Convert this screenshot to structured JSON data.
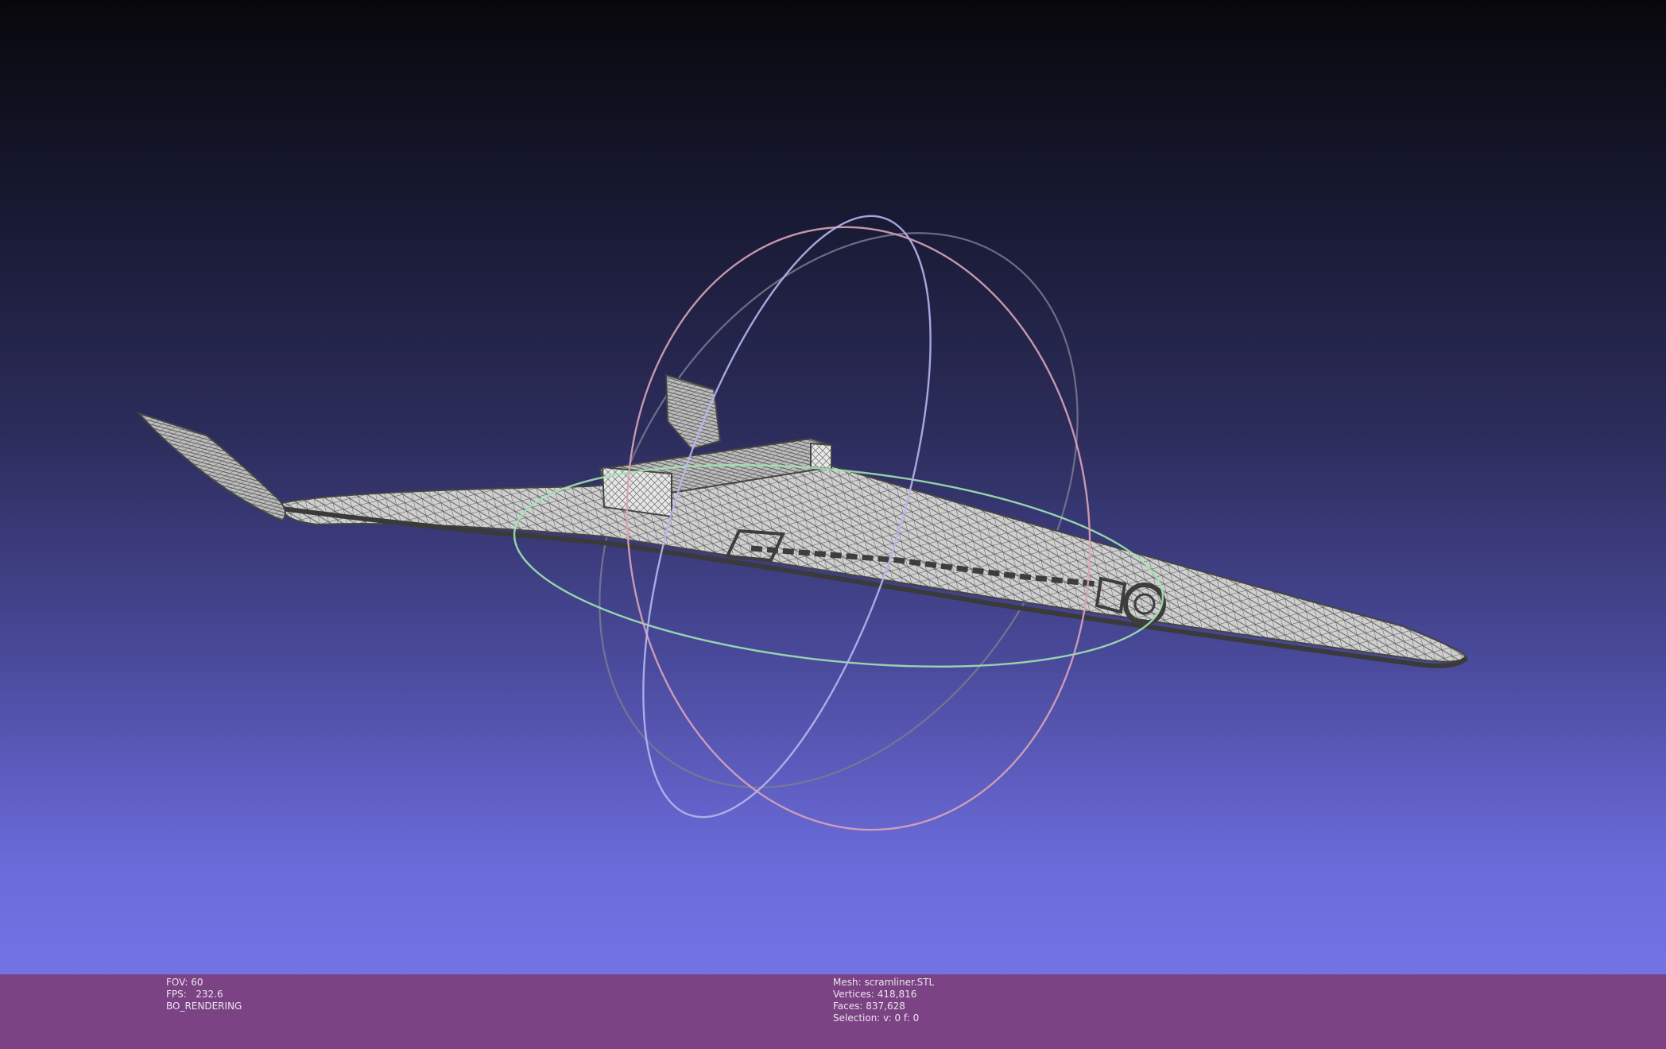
{
  "app": {
    "view": "3D mesh viewport"
  },
  "info_left": {
    "fov_label": "FOV:",
    "fov_value": "60",
    "fps_label": "FPS:",
    "fps_value": "232.6",
    "render_mode": "BO_RENDERING"
  },
  "info_right": {
    "mesh_label": "Mesh:",
    "mesh_name": "scramliner.STL",
    "vertices_label": "Vertices:",
    "vertices_value": "418,816",
    "faces_label": "Faces:",
    "faces_value": "837,628",
    "selection_label": "Selection:",
    "selection_value": "v: 0 f: 0"
  },
  "colors": {
    "background_top": "#08080c",
    "background_bottom": "#7373e6",
    "info_bar": "#7c4384",
    "mesh_fill": "#c9c9c9",
    "mesh_wire": "#4a4a4a",
    "trackball_x": "#e7a3b0",
    "trackball_y": "#b6b6f0",
    "trackball_z": "#9ee4b0"
  },
  "icons": [
    "trackball-gizmo-icon"
  ]
}
